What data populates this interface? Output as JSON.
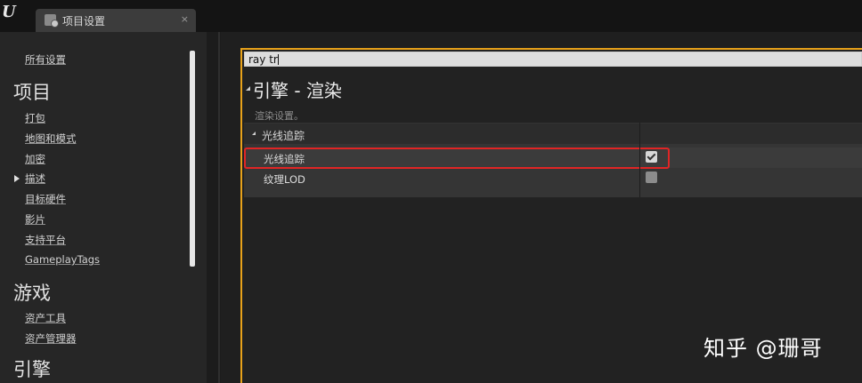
{
  "window": {
    "tab_label": "项目设置",
    "tab_close": "×"
  },
  "sidebar": {
    "all_settings": "所有设置",
    "headings": [
      "项目",
      "游戏",
      "引擎"
    ],
    "project_items": [
      "打包",
      "地图和模式",
      "加密",
      "描述",
      "目标硬件",
      "影片",
      "支持平台",
      "GameplayTags"
    ],
    "game_items": [
      "资产工具",
      "资产管理器"
    ]
  },
  "search": {
    "value": "ray tr"
  },
  "section": {
    "title": "引擎 - 渲染",
    "description": "渲染设置。"
  },
  "category": {
    "label": "光线追踪"
  },
  "properties": [
    {
      "label": "光线追踪",
      "checked": true
    },
    {
      "label": "纹理LOD",
      "checked": false
    }
  ],
  "watermark": "知乎 @珊哥",
  "colors": {
    "accent": "#e8a21a",
    "highlight": "#e02525"
  }
}
